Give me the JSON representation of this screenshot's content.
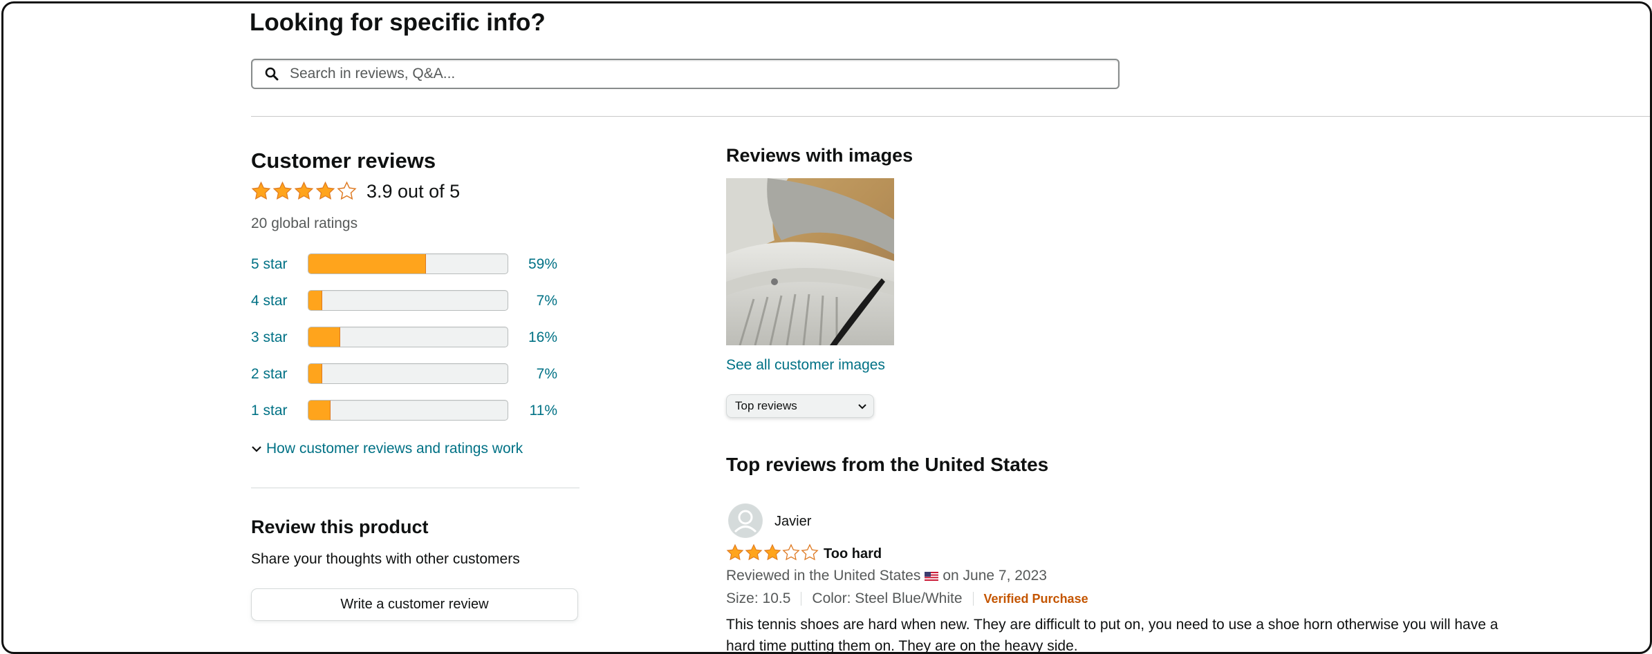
{
  "search": {
    "heading": "Looking for specific info?",
    "placeholder": "Search in reviews, Q&A..."
  },
  "summary": {
    "heading": "Customer reviews",
    "rating": 3.9,
    "rating_text": "3.9 out of 5",
    "global_ratings": "20 global ratings",
    "histogram": [
      {
        "label": "5 star",
        "percent": 59,
        "percent_text": "59%"
      },
      {
        "label": "4 star",
        "percent": 7,
        "percent_text": "7%"
      },
      {
        "label": "3 star",
        "percent": 16,
        "percent_text": "16%"
      },
      {
        "label": "2 star",
        "percent": 7,
        "percent_text": "7%"
      },
      {
        "label": "1 star",
        "percent": 11,
        "percent_text": "11%"
      }
    ],
    "how_link": "How customer reviews and ratings work"
  },
  "review_product": {
    "heading": "Review this product",
    "subtext": "Share your thoughts with other customers",
    "button_label": "Write a customer review"
  },
  "images_section": {
    "heading": "Reviews with images",
    "see_all": "See all customer images"
  },
  "sort": {
    "selected": "Top reviews"
  },
  "top_reviews": {
    "heading": "Top reviews from the United States",
    "review": {
      "reviewer": "Javier",
      "stars": 3,
      "title": "Too hard",
      "reviewed_prefix": "Reviewed in the United States",
      "reviewed_date": "on June 7, 2023",
      "size": "Size: 10.5",
      "color": "Color: Steel Blue/White",
      "verified": "Verified Purchase",
      "body": "This tennis shoes are hard when new. They are difficult to put on, you need to use a shoe horn otherwise you will have a hard time putting them on. They are on the heavy side."
    }
  },
  "colors": {
    "star": "#ffa41c",
    "link": "#007185",
    "verified": "#c45500"
  }
}
